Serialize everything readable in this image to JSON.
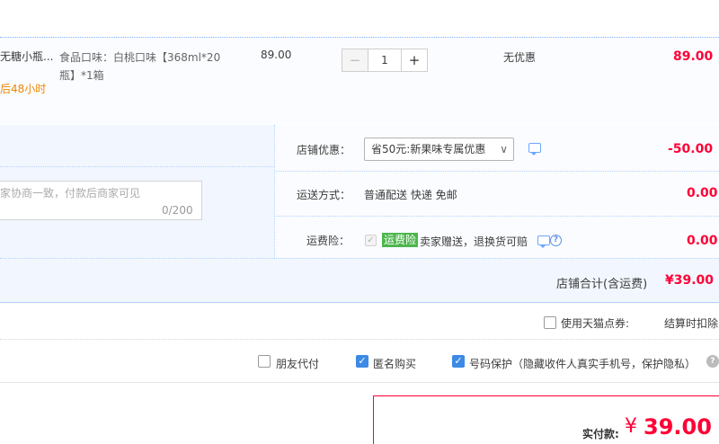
{
  "item": {
    "title": "无糖小瓶...",
    "promise": "后48小时",
    "sku": "食品口味：白桃口味【368ml*20瓶】*1箱",
    "price": "89.00",
    "qty_minus": "−",
    "qty_value": "1",
    "qty_plus": "+",
    "promo": "无优惠",
    "total": "89.00"
  },
  "message": {
    "placeholder": "家协商一致，付款后商家可见",
    "count": "0/200"
  },
  "options": {
    "discount_label": "店铺优惠：",
    "discount_value": "省50元:新果味专属优惠",
    "discount_amount": "-50.00",
    "shipping_label": "运送方式：",
    "shipping_value": "普通配送 快递 免邮",
    "shipping_amount": "0.00",
    "insurance_label": "运费险：",
    "insurance_badge": "运费险",
    "insurance_desc": "卖家赠送，退换货可赔",
    "insurance_amount": "0.00"
  },
  "store_total": {
    "label": "店铺合计(含运费)",
    "value": "¥39.00"
  },
  "points": {
    "label": "使用天猫点券:",
    "note": "结算时扣除"
  },
  "extras": {
    "friend_pay": "朋友代付",
    "anonymous": "匿名购买",
    "phone_protect": "号码保护（隐藏收件人真实手机号，保护隐私）"
  },
  "pay": {
    "label": "实付款:",
    "currency": "¥",
    "amount": "39.00"
  },
  "colors": {
    "price_red": "#ff0036",
    "accent_blue": "#3c8ae6",
    "promise_orange": "#f08700",
    "badge_green": "#4db64d"
  }
}
